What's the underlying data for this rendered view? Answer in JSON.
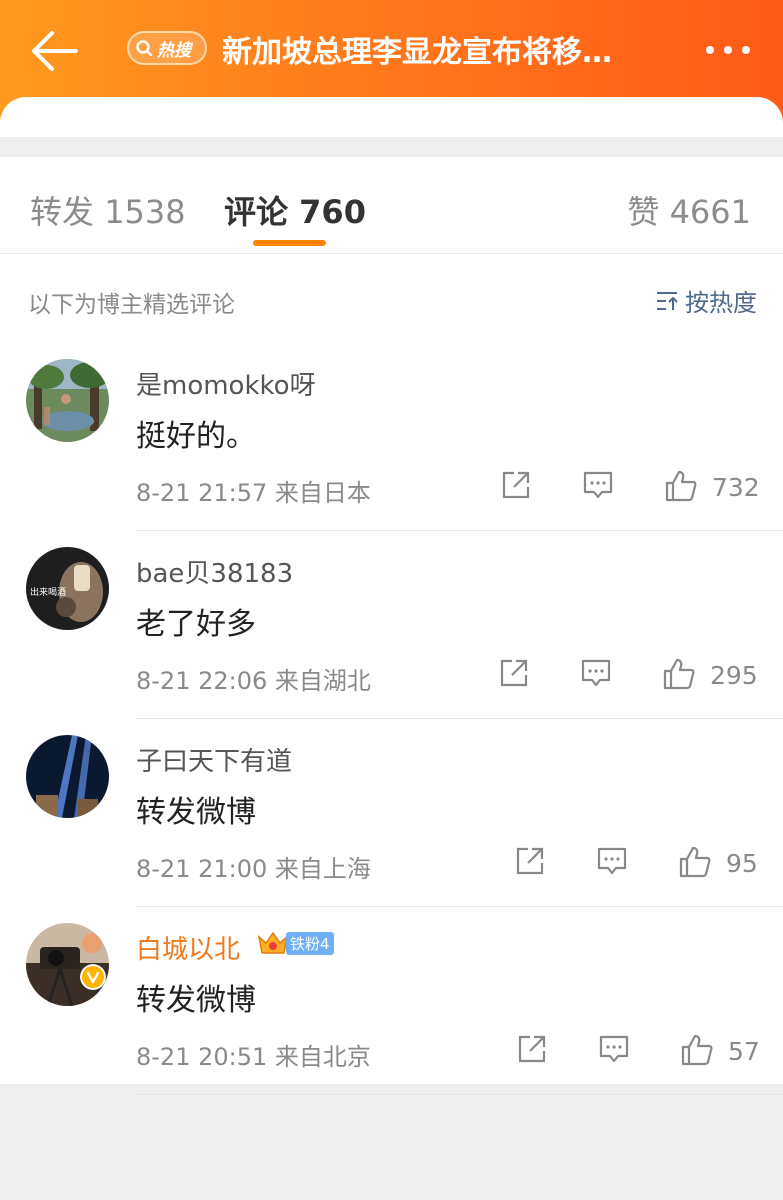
{
  "header": {
    "title": "新加坡总理李显龙宣布将移…",
    "hot_label": "热搜",
    "colors": {
      "start": "#ff9a1f",
      "end": "#ff5a17"
    }
  },
  "tabs": [
    {
      "label": "转发",
      "count": "1538"
    },
    {
      "label": "评论",
      "count": "760"
    },
    {
      "label": "赞",
      "count": "4661"
    }
  ],
  "filter": {
    "label": "以下为博主精选评论",
    "sort_label": "按热度"
  },
  "comments": [
    {
      "username": "是momokko呀",
      "text": "挺好的。",
      "time": "8-21 21:57",
      "location": "来自日本",
      "likes": "732",
      "avatar": "garden-scene-avatar"
    },
    {
      "username": "bae贝38183",
      "avatar_text": "出来喝酒",
      "text": "老了好多",
      "time": "8-21 22:06",
      "location": "来自湖北",
      "likes": "295",
      "avatar": "drink-glass-avatar"
    },
    {
      "username": "子曰天下有道",
      "text": "转发微博",
      "time": "8-21 21:00",
      "location": "来自上海",
      "likes": "95",
      "avatar": "light-beams-avatar"
    },
    {
      "username": "白城以北",
      "fan_badge": "铁粉4",
      "text": "转发微博",
      "time": "8-21 20:51",
      "location": "来自北京",
      "likes": "57",
      "avatar": "camera-avatar",
      "verified": true
    }
  ]
}
